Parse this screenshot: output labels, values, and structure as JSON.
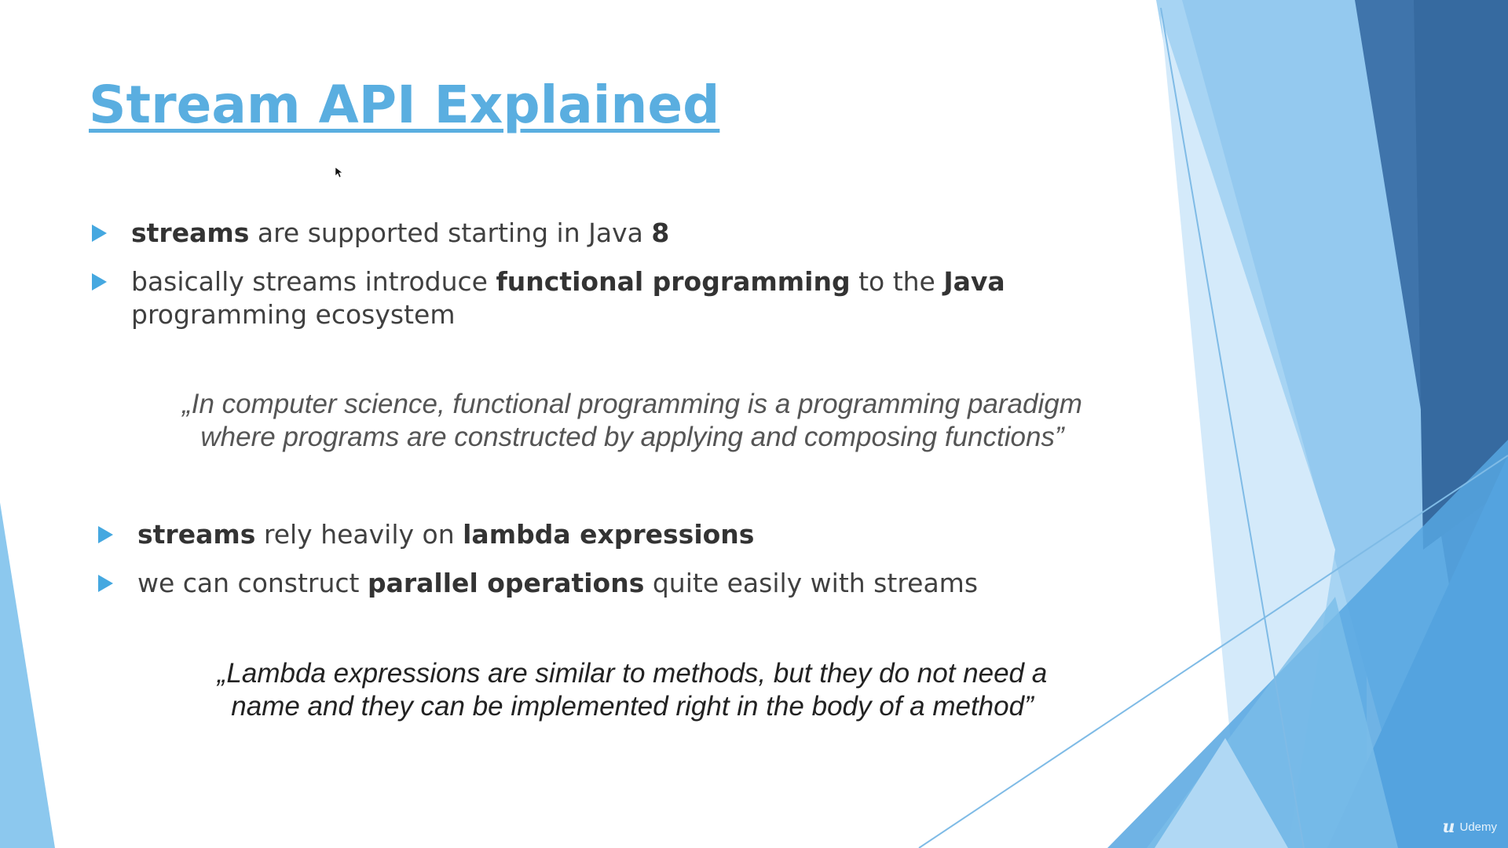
{
  "slide": {
    "title": "Stream API Explained",
    "bullets_top": [
      {
        "parts": [
          {
            "text": "streams",
            "bold": true
          },
          {
            "text": " are supported starting in Java ",
            "bold": false
          },
          {
            "text": "8",
            "bold": true
          }
        ]
      },
      {
        "parts": [
          {
            "text": "basically streams introduce ",
            "bold": false
          },
          {
            "text": "functional programming",
            "bold": true
          },
          {
            "text": " to the ",
            "bold": false
          },
          {
            "text": "Java",
            "bold": true
          },
          {
            "text": " programming ecosystem",
            "bold": false
          }
        ]
      }
    ],
    "quote_1": {
      "line_1": "„In computer science, functional programming is a programming paradigm",
      "line_2": "where programs are constructed by applying and composing functions”"
    },
    "bullets_bottom": [
      {
        "parts": [
          {
            "text": "streams",
            "bold": true
          },
          {
            "text": " rely heavily on ",
            "bold": false
          },
          {
            "text": "lambda expressions",
            "bold": true
          }
        ]
      },
      {
        "parts": [
          {
            "text": "we can construct ",
            "bold": false
          },
          {
            "text": "parallel operations",
            "bold": true
          },
          {
            "text": " quite easily with streams",
            "bold": false
          }
        ]
      }
    ],
    "quote_2": {
      "line_1": "„Lambda expressions are similar to methods, but they do not need a",
      "line_2": "name and they can be implemented right in the body of a method”"
    },
    "bullet_icon": "triangle-right-icon",
    "watermark": {
      "logo_icon": "udemy-logo-icon",
      "text": "Udemy"
    }
  },
  "colors": {
    "title": "#5aaee0",
    "bullet_arrow": "#45a8e0",
    "body_text": "#404040",
    "quote_1_text": "#555555",
    "quote_2_text": "#222222",
    "accent_dark": "#3a6fa5",
    "accent_mid": "#4f9ad8",
    "accent_light": "#a9d4f2"
  }
}
